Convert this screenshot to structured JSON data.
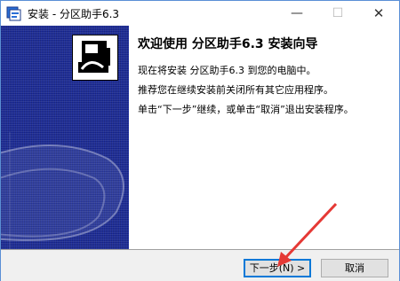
{
  "window": {
    "title": "安装 - 分区助手6.3",
    "controls": {
      "minimize": "—",
      "maximize": "☐",
      "close": "✕"
    }
  },
  "content": {
    "heading": "欢迎使用 分区助手6.3 安装向导",
    "lines": [
      "现在将安装 分区助手6.3 到您的电脑中。",
      "推荐您在继续安装前关闭所有其它应用程序。",
      "单击“下一步”继续，或单击“取消”退出安装程序。"
    ]
  },
  "buttons": {
    "next": "下一步(N) >",
    "cancel": "取消"
  },
  "colors": {
    "side_panel": "#1a2a9a",
    "arrow": "#e53935",
    "focus_border": "#0078d7"
  }
}
